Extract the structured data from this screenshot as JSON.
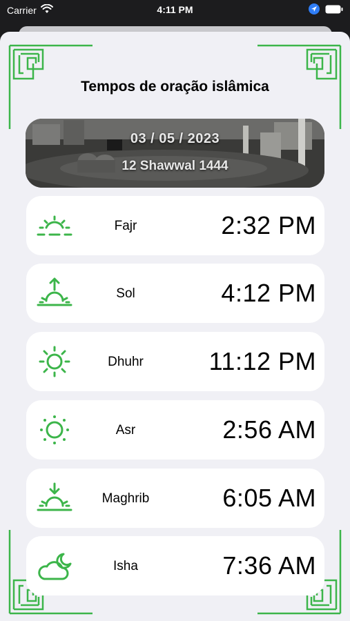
{
  "status_bar": {
    "carrier": "Carrier",
    "time": "4:11 PM"
  },
  "title": "Tempos de oração islâmica",
  "banner": {
    "gregorian_date": "03 / 05 / 2023",
    "hijri_date": "12 Shawwal 1444"
  },
  "accent_color": "#3cb54a",
  "prayers": [
    {
      "name": "Fajr",
      "time": "2:32 PM",
      "icon": "dawn-icon"
    },
    {
      "name": "Sol",
      "time": "4:12 PM",
      "icon": "sunrise-icon"
    },
    {
      "name": "Dhuhr",
      "time": "11:12 PM",
      "icon": "sun-icon"
    },
    {
      "name": "Asr",
      "time": "2:56 AM",
      "icon": "sun-dotted-icon"
    },
    {
      "name": "Maghrib",
      "time": "6:05 AM",
      "icon": "sunset-icon"
    },
    {
      "name": "Isha",
      "time": "7:36 AM",
      "icon": "cloud-moon-icon"
    }
  ]
}
